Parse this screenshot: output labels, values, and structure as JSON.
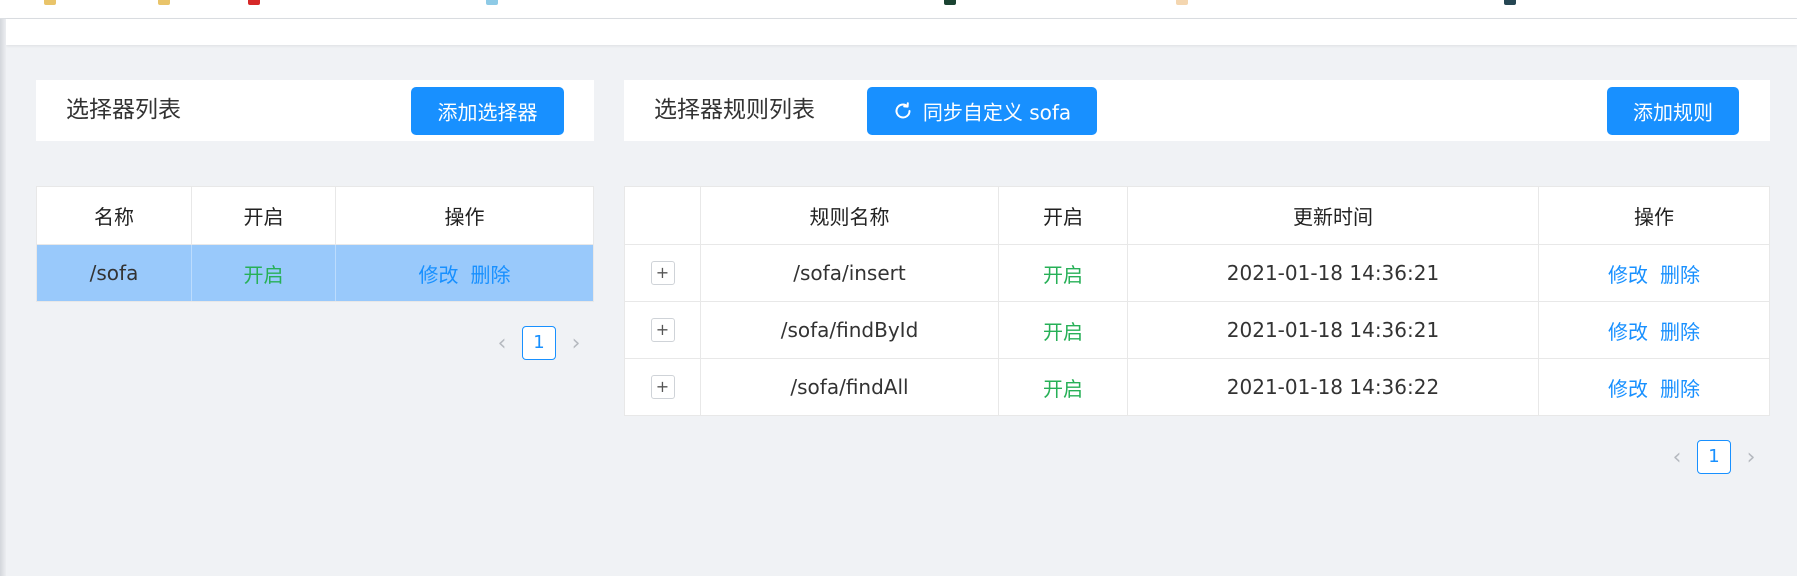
{
  "colors": {
    "primary": "#1890ff",
    "enabled_green": "#27b057",
    "selected_row": "#99c9fb"
  },
  "selector_panel": {
    "title": "选择器列表",
    "add_button": "添加选择器",
    "table": {
      "headers": [
        "名称",
        "开启",
        "操作"
      ],
      "rows": [
        {
          "name": "/sofa",
          "enabled": "开启",
          "edit": "修改",
          "delete": "删除"
        }
      ]
    },
    "pagination": {
      "current_page": "1"
    }
  },
  "rule_panel": {
    "title": "选择器规则列表",
    "sync_button": "同步自定义 sofa",
    "add_button": "添加规则",
    "table": {
      "headers": [
        "",
        "规则名称",
        "开启",
        "更新时间",
        "操作"
      ],
      "rows": [
        {
          "expand": "+",
          "name": "/sofa/insert",
          "enabled": "开启",
          "updated": "2021-01-18 14:36:21",
          "edit": "修改",
          "delete": "删除"
        },
        {
          "expand": "+",
          "name": "/sofa/findById",
          "enabled": "开启",
          "updated": "2021-01-18 14:36:21",
          "edit": "修改",
          "delete": "删除"
        },
        {
          "expand": "+",
          "name": "/sofa/findAll",
          "enabled": "开启",
          "updated": "2021-01-18 14:36:22",
          "edit": "修改",
          "delete": "删除"
        }
      ]
    },
    "pagination": {
      "current_page": "1"
    }
  }
}
